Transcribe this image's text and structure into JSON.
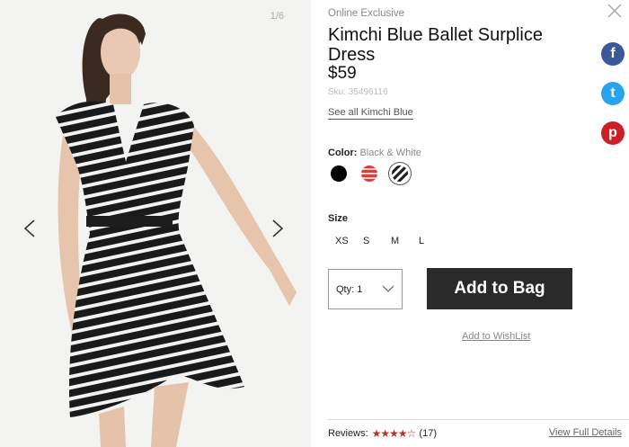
{
  "gallery": {
    "counter": "1/6",
    "prev_icon": "chevron-left-icon",
    "next_icon": "chevron-right-icon"
  },
  "product": {
    "badge": "Online Exclusive",
    "title": "Kimchi Blue Ballet Surplice Dress",
    "price": "$59",
    "sku": "Sku: 35496116",
    "see_all": "See all Kimchi Blue"
  },
  "color": {
    "label": "Color:",
    "selected": "Black & White",
    "swatches": [
      {
        "name": "Black",
        "hex": "#000000"
      },
      {
        "name": "Red",
        "hex": "#e23b3b"
      },
      {
        "name": "Black & White",
        "hex": "#222222"
      }
    ]
  },
  "size": {
    "label": "Size",
    "options": [
      "XS",
      "S",
      "M",
      "L"
    ]
  },
  "purchase": {
    "qty_label": "Qty: 1",
    "add_to_bag": "Add to Bag",
    "wishlist": "Add to WishList"
  },
  "reviews": {
    "label": "Reviews:",
    "rating": 4.5,
    "count": "(17)",
    "view_full": "View Full Details"
  },
  "social": {
    "facebook": "f",
    "twitter": "t",
    "pinterest": "p"
  },
  "colors": {
    "button_dark": "#2a2a2a",
    "star_red": "#b5342c",
    "facebook": "#3b5998",
    "twitter": "#2aa3ef",
    "pinterest": "#cb2027"
  }
}
